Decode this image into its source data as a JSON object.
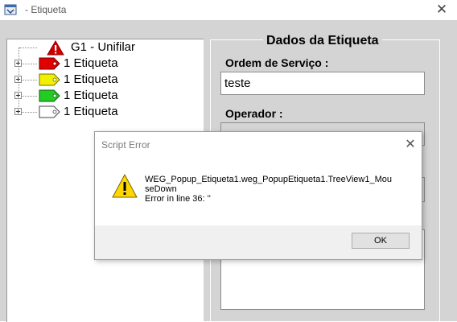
{
  "window": {
    "title": "- Etiqueta",
    "close_glyph": "✕",
    "app_icon": "app-window-icon"
  },
  "tree": {
    "root": {
      "label": "G1 - Unifilar",
      "icon": "warning-triangle-icon",
      "icon_color": "#cc0000"
    },
    "items": [
      {
        "label": "1 Etiqueta",
        "tag_color": "#e00000",
        "expand_glyph": "+"
      },
      {
        "label": "1 Etiqueta",
        "tag_color": "#f0f000",
        "expand_glyph": "+"
      },
      {
        "label": "1 Etiqueta",
        "tag_color": "#22cc22",
        "expand_glyph": "+"
      },
      {
        "label": "1 Etiqueta",
        "tag_color": "#ffffff",
        "expand_glyph": "+"
      }
    ]
  },
  "form": {
    "title": "Dados da Etiqueta",
    "ordem_label": "Ordem de Serviço :",
    "ordem_value": "teste",
    "operador_label": "Operador :",
    "operador_value": ""
  },
  "dialog": {
    "title": "Script Error",
    "close_glyph": "✕",
    "message_line1": "WEG_Popup_Etiqueta1.weg_PopupEtiqueta1.TreeView1_Mou",
    "message_line2": "seDown",
    "message_line3": "Error in line 36: ''",
    "ok_label": "OK",
    "icon": "warning-icon",
    "icon_color": "#ffd800"
  }
}
